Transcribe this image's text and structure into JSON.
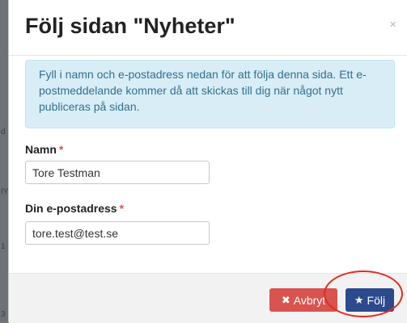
{
  "background": {
    "fragments": [
      "d",
      "IY",
      "1",
      "3"
    ]
  },
  "modal": {
    "title": "Följ sidan \"Nyheter\"",
    "close_icon": "×",
    "info_text": "Fyll i namn och e-postadress nedan för att följa denna sida. Ett e-postmeddelande kommer då att skickas till dig när något nytt publiceras på sidan.",
    "fields": [
      {
        "label": "Namn",
        "required_marker": "*",
        "value": "Tore Testman"
      },
      {
        "label": "Din e-postadress",
        "required_marker": "*",
        "value": "tore.test@test.se"
      }
    ],
    "buttons": {
      "cancel": {
        "icon": "✖",
        "label": "Avbryt"
      },
      "follow": {
        "icon": "★",
        "label": "Följ"
      }
    }
  },
  "colors": {
    "info_bg": "#d9edf7",
    "info_text": "#31708f",
    "required": "#d9534f",
    "cancel_button": "#d9534f",
    "follow_button": "#2c4a8c",
    "highlight_ring": "#e52a20"
  }
}
